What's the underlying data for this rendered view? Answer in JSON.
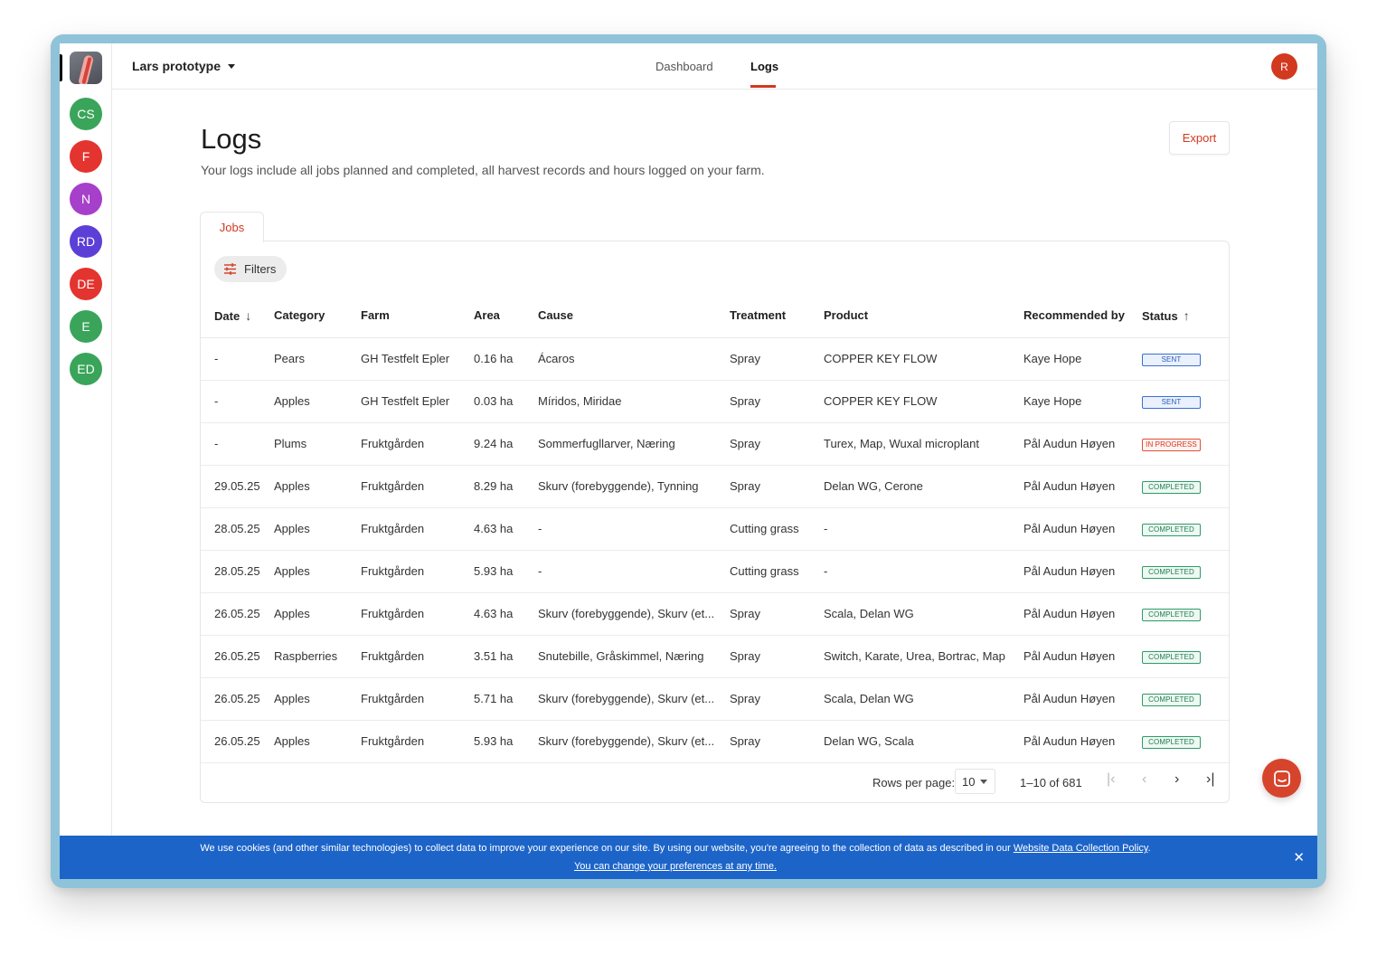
{
  "rail": {
    "avatars": [
      {
        "initials": "CS",
        "color": "#3aa55a"
      },
      {
        "initials": "F",
        "color": "#e3342f"
      },
      {
        "initials": "N",
        "color": "#a63fc9"
      },
      {
        "initials": "RD",
        "color": "#5b3fd6"
      },
      {
        "initials": "DE",
        "color": "#e3342f"
      },
      {
        "initials": "E",
        "color": "#3aa55a"
      },
      {
        "initials": "ED",
        "color": "#3aa55a"
      }
    ]
  },
  "topbar": {
    "farm_name": "Lars prototype",
    "nav": {
      "dashboard": "Dashboard",
      "logs": "Logs"
    },
    "user_initial": "R"
  },
  "page": {
    "title": "Logs",
    "subtitle": "Your logs include all jobs planned and completed, all harvest records and hours logged on your farm.",
    "export_label": "Export",
    "tab_jobs": "Jobs",
    "filters_label": "Filters"
  },
  "table": {
    "columns": [
      "Date",
      "Category",
      "Farm",
      "Area",
      "Cause",
      "Treatment",
      "Product",
      "Recommended by",
      "Status"
    ],
    "rows": [
      {
        "date": "-",
        "category": "Pears",
        "farm": "GH Testfelt Epler",
        "area": "0.16 ha",
        "cause": "Ácaros",
        "treatment": "Spray",
        "product": "COPPER KEY FLOW",
        "recommended_by": "Kaye Hope",
        "status": "SENT",
        "status_type": "sent"
      },
      {
        "date": "-",
        "category": "Apples",
        "farm": "GH Testfelt Epler",
        "area": "0.03 ha",
        "cause": "Míridos, Miridae",
        "treatment": "Spray",
        "product": "COPPER KEY FLOW",
        "recommended_by": "Kaye Hope",
        "status": "SENT",
        "status_type": "sent"
      },
      {
        "date": "-",
        "category": "Plums",
        "farm": "Fruktgården",
        "area": "9.24 ha",
        "cause": "Sommerfugllarver, Næring",
        "treatment": "Spray",
        "product": "Turex, Map, Wuxal microplant",
        "recommended_by": "Pål Audun Høyen",
        "status": "IN PROGRESS",
        "status_type": "progress"
      },
      {
        "date": "29.05.25",
        "category": "Apples",
        "farm": "Fruktgården",
        "area": "8.29 ha",
        "cause": "Skurv (forebyggende), Tynning",
        "treatment": "Spray",
        "product": "Delan WG, Cerone",
        "recommended_by": "Pål Audun Høyen",
        "status": "COMPLETED",
        "status_type": "completed"
      },
      {
        "date": "28.05.25",
        "category": "Apples",
        "farm": "Fruktgården",
        "area": "4.63 ha",
        "cause": "-",
        "treatment": "Cutting grass",
        "product": "-",
        "recommended_by": "Pål Audun Høyen",
        "status": "COMPLETED",
        "status_type": "completed"
      },
      {
        "date": "28.05.25",
        "category": "Apples",
        "farm": "Fruktgården",
        "area": "5.93 ha",
        "cause": "-",
        "treatment": "Cutting grass",
        "product": "-",
        "recommended_by": "Pål Audun Høyen",
        "status": "COMPLETED",
        "status_type": "completed"
      },
      {
        "date": "26.05.25",
        "category": "Apples",
        "farm": "Fruktgården",
        "area": "4.63 ha",
        "cause": "Skurv (forebyggende), Skurv (et...",
        "treatment": "Spray",
        "product": "Scala, Delan WG",
        "recommended_by": "Pål Audun Høyen",
        "status": "COMPLETED",
        "status_type": "completed"
      },
      {
        "date": "26.05.25",
        "category": "Raspberries",
        "farm": "Fruktgården",
        "area": "3.51 ha",
        "cause": "Snutebille, Gråskimmel, Næring",
        "treatment": "Spray",
        "product": "Switch, Karate, Urea, Bortrac, Map",
        "recommended_by": "Pål Audun Høyen",
        "status": "COMPLETED",
        "status_type": "completed"
      },
      {
        "date": "26.05.25",
        "category": "Apples",
        "farm": "Fruktgården",
        "area": "5.71 ha",
        "cause": "Skurv (forebyggende), Skurv (et...",
        "treatment": "Spray",
        "product": "Scala, Delan WG",
        "recommended_by": "Pål Audun Høyen",
        "status": "COMPLETED",
        "status_type": "completed"
      },
      {
        "date": "26.05.25",
        "category": "Apples",
        "farm": "Fruktgården",
        "area": "5.93 ha",
        "cause": "Skurv (forebyggende), Skurv (et...",
        "treatment": "Spray",
        "product": "Delan WG, Scala",
        "recommended_by": "Pål Audun Høyen",
        "status": "COMPLETED",
        "status_type": "completed"
      }
    ]
  },
  "pagination": {
    "rows_per_page_label": "Rows per page:",
    "rows_per_page_value": "10",
    "range": "1–10 of 681"
  },
  "cookie": {
    "text": "We use cookies (and other similar technologies) to collect data to improve your experience on our site. By using our website, you're agreeing to the collection of data as described in our",
    "policy_link": "Website Data Collection Policy",
    "preferences_link": "You can change your preferences at any time."
  },
  "colors": {
    "accent": "#d2391f",
    "cookie_bg": "#1d64c8"
  }
}
